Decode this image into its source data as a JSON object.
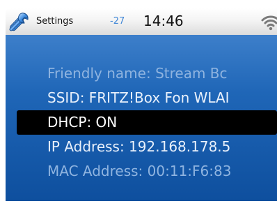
{
  "statusbar": {
    "app_icon": "wrench-icon",
    "title": "Settings",
    "signal": "-27",
    "time": "14:46",
    "wifi_icon": "wifi-icon"
  },
  "settings": {
    "items": [
      {
        "label": "Friendly name: Stream Bc",
        "state": "dim"
      },
      {
        "label": "SSID: FRITZ!Box Fon WLAI",
        "state": "normal"
      },
      {
        "label": "DHCP: ON",
        "state": "selected"
      },
      {
        "label": "IP Address: 192.168.178.5",
        "state": "normal"
      },
      {
        "label": "MAC Address: 00:11:F6:83",
        "state": "dim"
      }
    ]
  },
  "colors": {
    "screen_background": "#1f66b7",
    "selection_background": "#000000",
    "signal_text": "#3f86d6"
  }
}
